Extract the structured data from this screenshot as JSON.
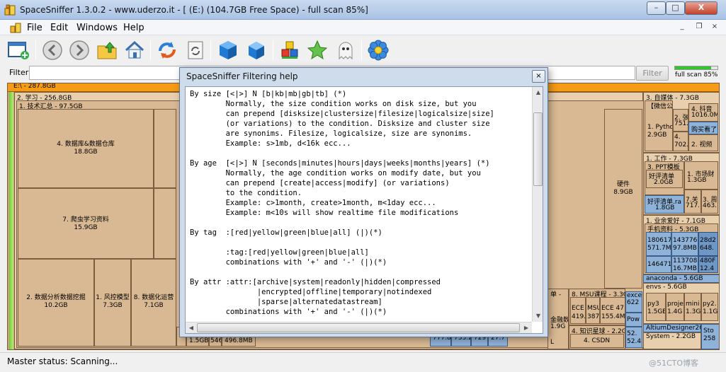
{
  "window": {
    "title": "SpaceSniffer 1.3.0.2 - www.uderzo.it - [ (E:) (104.7GB Free Space) - full scan 85%]",
    "min_glyph": "–",
    "max_glyph": "□",
    "close_glyph": "X"
  },
  "menu": {
    "file": "File",
    "edit": "Edit",
    "windows": "Windows",
    "help": "Help",
    "mdi_min": "_",
    "mdi_restore": "❐",
    "mdi_close": "×"
  },
  "toolbar": {
    "icons": [
      "new-view-icon",
      "back-icon",
      "forward-icon",
      "folder-up-icon",
      "home-icon",
      "refresh-icon",
      "rescan-icon",
      "zoom-in-cube-icon",
      "zoom-out-cube-icon",
      "blocks-icon",
      "star-icon",
      "ghost-icon",
      "settings-flower-icon"
    ]
  },
  "filter": {
    "label": "Filter",
    "button": "Filter",
    "scan_progress": 0.85,
    "scan_text": "full scan 85%"
  },
  "treemap": {
    "drive": "E:\\ - 287.8GB",
    "study": "2. 学习 - 256.8GB",
    "tech": "1. 技术汇总 - 97.5GB",
    "db": [
      "4. 数据库&数据仓库",
      "18.8GB"
    ],
    "crawler": [
      "7. 爬虫学习资料",
      "15.9GB"
    ],
    "mining": [
      "2. 数据分析数据挖掘",
      "10.2GB"
    ],
    "risk": [
      "1. 风控模型",
      "7.3GB"
    ],
    "ops": [
      "8. 数据化运营",
      "7.1GB"
    ],
    "hardware": [
      "硬件",
      "8.9GB"
    ],
    "bottom_small": [
      "1.5GB",
      "546",
      "496.8MB"
    ],
    "bottom_blue": [
      "777.8",
      "733.2",
      "729",
      "27.7"
    ],
    "msu": "8. MSU课程 - 3.3G",
    "msu_items": [
      "ECE",
      "419.",
      "MSU",
      "387.",
      "ECE 47",
      "155.4M"
    ],
    "knowledge": "4. 知识星球 - 2.2G",
    "csdn": "4. CSDN",
    "e622": [
      "exce",
      "622"
    ],
    "pow": "Pow",
    "s524": [
      "52.",
      "52.4"
    ],
    "gold": [
      "金融数",
      "1.9G"
    ],
    "l_single": "L",
    "unit_single": "单 -",
    "media": "3. 自媒体 - 7.3GB",
    "wechat": "【微信公众号】",
    "python": [
      "1. Pytho",
      "2.9GB"
    ],
    "m751": [
      "2. 张",
      "751."
    ],
    "m702": [
      "4.",
      "702."
    ],
    "m1016": [
      "4. 抖音",
      "1016.0M"
    ],
    "buy": "购买看了",
    "sudo": "购入安装",
    "video": "2. 视频",
    "work": "1. 工作 - 7.3GB",
    "ppt": "3. PPT模板",
    "market": [
      "1. 市场财",
      "1.3GB"
    ],
    "good": [
      "好评清单",
      "2.0GB"
    ],
    "good_ra": [
      "好评清单.ra",
      "1.8GB"
    ],
    "seven": [
      "7.关",
      "717."
    ],
    "three": [
      "3. 周",
      "463."
    ],
    "biz": "1. 业余爱好 - 7.1GB",
    "phone": "手机资料 - 5.3GB",
    "cells": [
      "1806179",
      "571.7M",
      "143776",
      "97.8MB",
      "28d2",
      "648.",
      "1464716",
      "113708",
      "16.7MB",
      "480F",
      "12.4"
    ],
    "anaconda": "anaconda - 5.6GB",
    "envs": "envs - 5.6GB",
    "py3": [
      "py3",
      "1.5GE"
    ],
    "proj": [
      "proje",
      "1.4G"
    ],
    "mini": [
      "mini",
      "1.3G"
    ],
    "py2": [
      "py2.",
      "1.1G"
    ],
    "altium": "AltiumDesigner2013",
    "system": "System - 2.2GB",
    "sto": [
      "Sto",
      "258"
    ]
  },
  "status": {
    "text": "Master status: Scanning...",
    "watermark": "@51CTO博客"
  },
  "dialog": {
    "title": "SpaceSniffer Filtering help",
    "close_glyph": "×",
    "scroll_up": "▲",
    "scroll_down": "▼",
    "scroll_left": "◀",
    "scroll_right": "▶",
    "help_text": "By size [<|>] N [b|kb|mb|gb|tb] (*)\n        Normally, the size condition works on disk size, but you\n        can prepend [disksize|clustersize|filesize|logicalsize|size]\n        (or variations) to the condition. Disksize and cluster size\n        are synonims. Filesize, logicalsize, size are synonims.\n        Example: s>1mb, d<16k ecc...\n\nBy age  [<|>] N [seconds|minutes|hours|days|weeks|months|years] (*)\n        Normally, the age condition works on modify date, but you\n        can prepend [create|access|modify] (or variations)\n        to the condition.\n        Example: c>1month, create>1month, m<1day ecc...\n        Example: m<10s will show realtime file modifications\n\nBy tag  :[red|yellow|green|blue|all] (|)(*)\n\n        :tag:[red|yellow|green|blue|all]\n        combinations with '+' and '-' (|)(*)\n\nBy attr :attr:[archive|system|readonly|hidden|compressed\n               |encrypted|offline|temporary|notindexed\n               |sparse|alternatedatastream]\n        combinations with '+' and '-' (|)(*)"
  }
}
